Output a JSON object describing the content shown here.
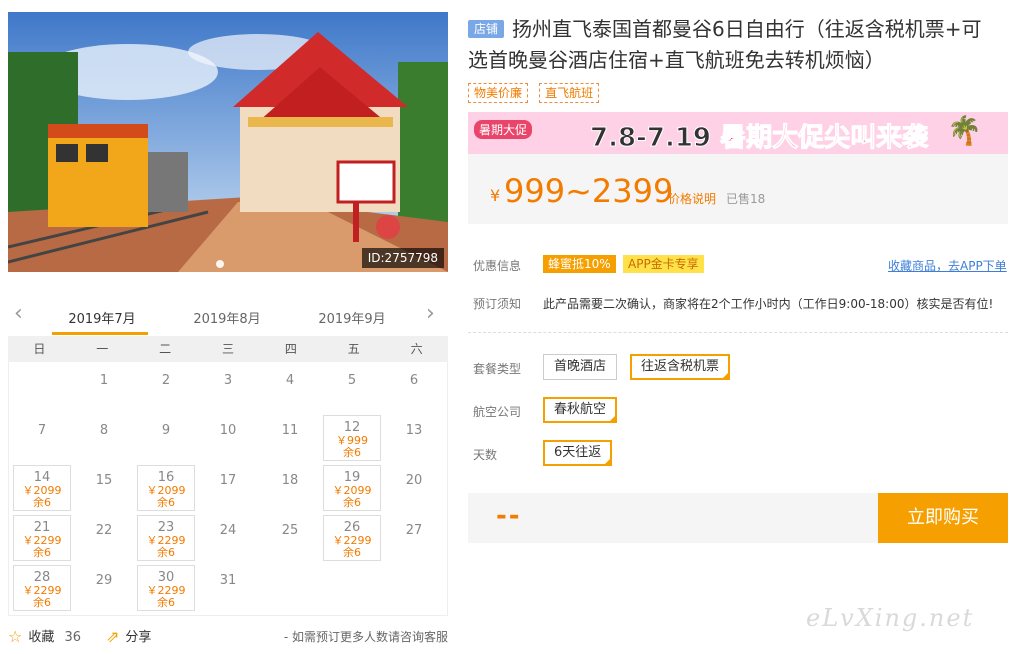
{
  "hero": {
    "id_label": "ID:2757798"
  },
  "calendar": {
    "months": [
      "2019年7月",
      "2019年8月",
      "2019年9月"
    ],
    "weekdays": [
      "日",
      "一",
      "二",
      "三",
      "四",
      "五",
      "六"
    ],
    "days": [
      {
        "d": "1",
        "col": 1,
        "row": 0
      },
      {
        "d": "2",
        "col": 2,
        "row": 0
      },
      {
        "d": "3",
        "col": 3,
        "row": 0
      },
      {
        "d": "4",
        "col": 4,
        "row": 0
      },
      {
        "d": "5",
        "col": 5,
        "row": 0
      },
      {
        "d": "6",
        "col": 6,
        "row": 0
      },
      {
        "d": "7",
        "col": 0,
        "row": 1
      },
      {
        "d": "8",
        "col": 1,
        "row": 1
      },
      {
        "d": "9",
        "col": 2,
        "row": 1
      },
      {
        "d": "10",
        "col": 3,
        "row": 1
      },
      {
        "d": "11",
        "col": 4,
        "row": 1
      },
      {
        "d": "12",
        "col": 5,
        "row": 1,
        "price": "￥999",
        "stock": "余6"
      },
      {
        "d": "13",
        "col": 6,
        "row": 1
      },
      {
        "d": "14",
        "col": 0,
        "row": 2,
        "price": "￥2099",
        "stock": "余6"
      },
      {
        "d": "15",
        "col": 1,
        "row": 2
      },
      {
        "d": "16",
        "col": 2,
        "row": 2,
        "price": "￥2099",
        "stock": "余6"
      },
      {
        "d": "17",
        "col": 3,
        "row": 2
      },
      {
        "d": "18",
        "col": 4,
        "row": 2
      },
      {
        "d": "19",
        "col": 5,
        "row": 2,
        "price": "￥2099",
        "stock": "余6"
      },
      {
        "d": "20",
        "col": 6,
        "row": 2
      },
      {
        "d": "21",
        "col": 0,
        "row": 3,
        "price": "￥2299",
        "stock": "余6"
      },
      {
        "d": "22",
        "col": 1,
        "row": 3
      },
      {
        "d": "23",
        "col": 2,
        "row": 3,
        "price": "￥2299",
        "stock": "余6"
      },
      {
        "d": "24",
        "col": 3,
        "row": 3
      },
      {
        "d": "25",
        "col": 4,
        "row": 3
      },
      {
        "d": "26",
        "col": 5,
        "row": 3,
        "price": "￥2299",
        "stock": "余6"
      },
      {
        "d": "27",
        "col": 6,
        "row": 3
      },
      {
        "d": "28",
        "col": 0,
        "row": 4,
        "price": "￥2299",
        "stock": "余6"
      },
      {
        "d": "29",
        "col": 1,
        "row": 4
      },
      {
        "d": "30",
        "col": 2,
        "row": 4,
        "price": "￥2299",
        "stock": "余6"
      },
      {
        "d": "31",
        "col": 3,
        "row": 4
      }
    ]
  },
  "footer": {
    "favorite_label": "收藏",
    "favorite_count": "36",
    "share_label": "分享",
    "note": "- 如需预订更多人数请咨询客服"
  },
  "product": {
    "shop_badge": "店铺",
    "title": "扬州直飞泰国首都曼谷6日自由行（往返含税机票+可选首晚曼谷酒店住宿+直飞航班免去转机烦恼）",
    "tags": [
      "物美价廉",
      "直飞航班"
    ]
  },
  "banner": {
    "sub": "暑期大促",
    "dates": "7.8-7.19",
    "text": "暑期大促尖叫来袭"
  },
  "price": {
    "currency": "¥",
    "range": "999~2399",
    "explain_link": "价格说明",
    "sold": "已售18"
  },
  "promo": {
    "label": "优惠信息",
    "coupon1": "蜂蜜抵10%",
    "coupon2": "APP金卡专享",
    "app_link": "收藏商品，去APP下单"
  },
  "booking": {
    "label": "预订须知",
    "text": "此产品需要二次确认，商家将在2个工作小时内（工作日9:00-18:00）核实是否有位!"
  },
  "options": {
    "package": {
      "label": "套餐类型",
      "choices": [
        "首晚酒店",
        "往返含税机票"
      ]
    },
    "airline": {
      "label": "航空公司",
      "choices": [
        "春秋航空"
      ]
    },
    "days": {
      "label": "天数",
      "choices": [
        "6天往返"
      ]
    }
  },
  "buy": {
    "qty_placeholder": "--",
    "button_label": "立即购买"
  },
  "watermark": "eLvXing.net",
  "colors": {
    "accent": "#f5a000",
    "price": "#f27b00",
    "link": "#3d7fd8"
  }
}
